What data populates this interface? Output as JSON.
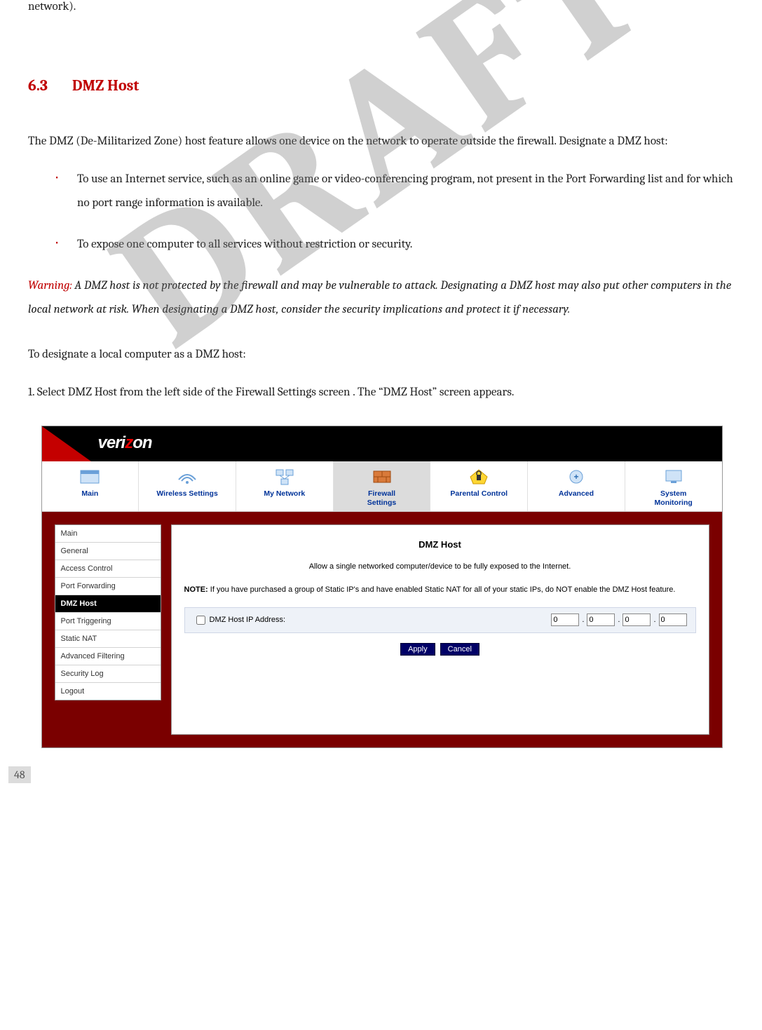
{
  "doc": {
    "top_fragment": "network).",
    "section_num": "6.3",
    "section_title": "DMZ Host",
    "intro": "The DMZ (De-Militarized Zone) host feature allows one device on the network to operate outside the firewall. Designate a DMZ host:",
    "bullets": [
      "To use an Internet service, such as an online game or video-conferencing program, not present in the Port Forwarding list and for which no port range information is available.",
      "To expose one computer to all services without restriction or security."
    ],
    "warning_label": "Warning:",
    "warning_text": " A DMZ host is not protected by the firewall and may be vulnerable to attack. Designating a DMZ host may also put other computers in the local network at risk. When designating a DMZ host, consider the security implications and protect it if necessary.",
    "lead_in": "To designate a local computer as a DMZ host:",
    "step1": "1.  Select DMZ Host from the left side of the Firewall Settings screen . The “DMZ Host” screen appears.",
    "page_number": "48",
    "watermark": "DRAFT"
  },
  "ui": {
    "brand_pre": "veri",
    "brand_z": "z",
    "brand_post": "on",
    "nav": [
      {
        "label": "Main",
        "icon": "main"
      },
      {
        "label": "Wireless Settings",
        "icon": "wireless"
      },
      {
        "label": "My Network",
        "icon": "network"
      },
      {
        "label": "Firewall\nSettings",
        "icon": "firewall",
        "active": true
      },
      {
        "label": "Parental Control",
        "icon": "parental"
      },
      {
        "label": "Advanced",
        "icon": "advanced"
      },
      {
        "label": "System\nMonitoring",
        "icon": "monitor"
      }
    ],
    "sidebar": [
      {
        "label": "Main"
      },
      {
        "label": "General"
      },
      {
        "label": "Access Control"
      },
      {
        "label": "Port Forwarding"
      },
      {
        "label": "DMZ Host",
        "active": true
      },
      {
        "label": "Port Triggering"
      },
      {
        "label": "Static NAT"
      },
      {
        "label": "Advanced Filtering"
      },
      {
        "label": "Security Log"
      },
      {
        "label": "Logout"
      }
    ],
    "panel": {
      "title": "DMZ Host",
      "subtitle": "Allow a single networked computer/device to be fully exposed to the Internet.",
      "note_bold": "NOTE:",
      "note_text": " If you have purchased a group of Static IP's and have enabled Static NAT for all of your static IPs, do NOT enable the DMZ Host feature.",
      "ip_label": "DMZ Host IP Address:",
      "ip": [
        "0",
        "0",
        "0",
        "0"
      ],
      "apply": "Apply",
      "cancel": "Cancel"
    }
  }
}
